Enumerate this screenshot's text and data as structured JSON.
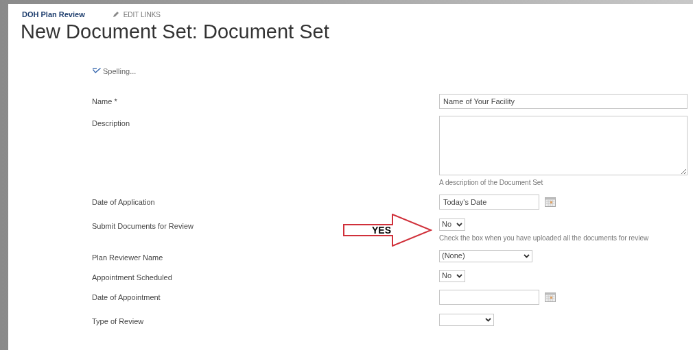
{
  "breadcrumb": {
    "site": "DOH Plan Review",
    "edit_links": "EDIT LINKS"
  },
  "title": "New Document Set: Document Set",
  "toolbar": {
    "spelling": "Spelling..."
  },
  "fields": [
    {
      "kind": "text",
      "label": "Name *",
      "value": "Name of Your Facility"
    },
    {
      "kind": "textarea",
      "label": "Description",
      "hint": "A description of the Document Set"
    },
    {
      "kind": "date",
      "label": "Date of Application",
      "value": "Today's Date"
    },
    {
      "kind": "select",
      "label": "Submit Documents for Review",
      "value": "No",
      "hint": "Check the box when you have uploaded all the documents for review"
    },
    {
      "kind": "select",
      "label": "Plan Reviewer Name",
      "value": "(None)"
    },
    {
      "kind": "select",
      "label": "Appointment Scheduled",
      "value": "No"
    },
    {
      "kind": "date",
      "label": "Date of Appointment"
    },
    {
      "kind": "select",
      "label": "Type of Review"
    }
  ],
  "annotation": {
    "text": "YES"
  }
}
